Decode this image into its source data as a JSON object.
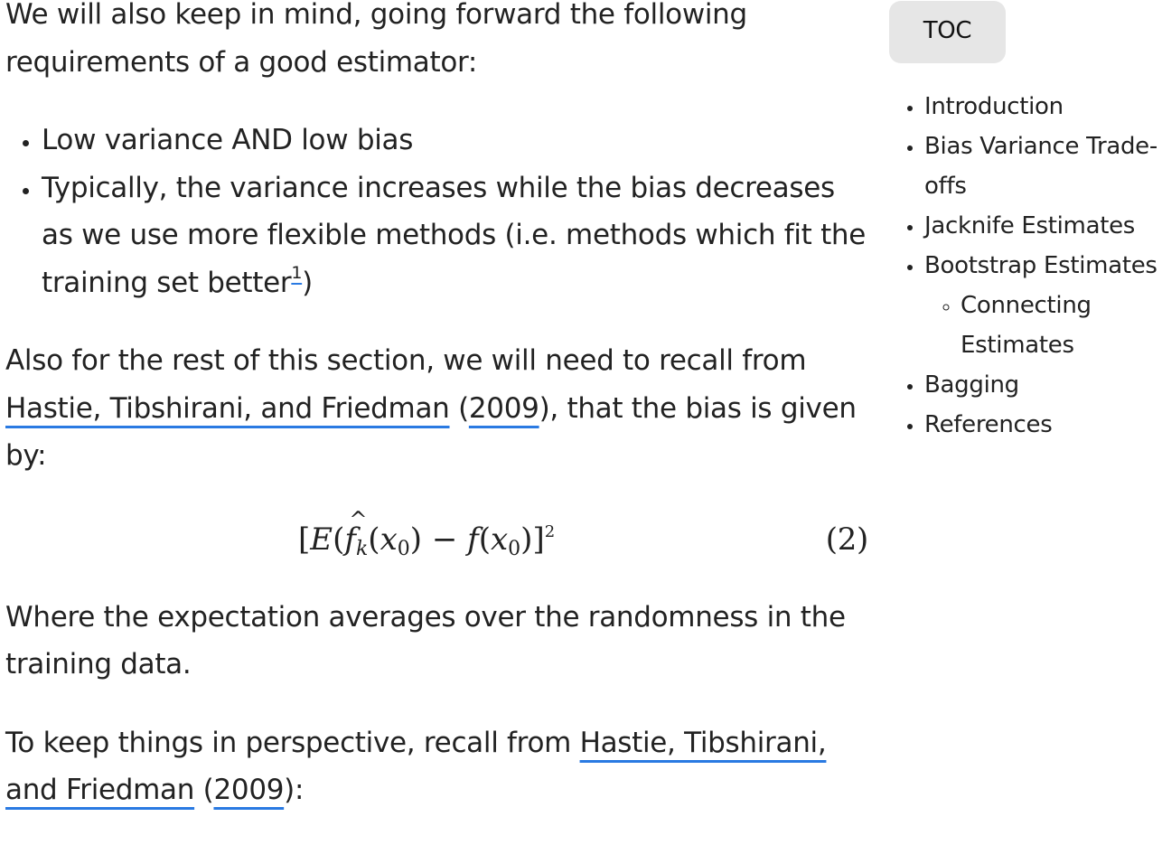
{
  "article": {
    "para1": "We will also keep in mind, going forward the following requirements of a good estimator:",
    "bullets": {
      "item1": "Low variance AND low bias",
      "item2_text": "Typically, the variance increases while the bias decreases as we use more flexible methods (i.e. methods which fit the training set better",
      "item2_footnote": "1",
      "item2_close": ")"
    },
    "para2": {
      "before": "Also for the rest of this section, we will need to recall from ",
      "cite_authors": "Hastie, Tibshirani, and Friedman",
      "paren_open": " (",
      "cite_year": "2009",
      "after": "), that the bias is given by:"
    },
    "equation": {
      "bracket_open": "[",
      "E": "E",
      "open_paren": "(",
      "f_hat": "f",
      "sub_k": "k",
      "arg1_open": "(",
      "x0a": "x",
      "sub0a": "0",
      "arg1_close": ")",
      "minus": " − ",
      "f": "f",
      "arg2_open": "(",
      "x0b": "x",
      "sub0b": "0",
      "arg2_close": ")",
      "bracket_close": "]",
      "power": "2",
      "number": "(2)"
    },
    "para3": "Where the expectation averages over the randomness in the training data.",
    "para4": {
      "before": "To keep things in perspective, recall from ",
      "cite_authors": "Hastie, Tibshirani, and Friedman",
      "paren_open": " (",
      "cite_year": "2009",
      "after": "):"
    }
  },
  "toc": {
    "button": "TOC",
    "items": [
      "Introduction",
      "Bias Variance Trade-offs",
      "Jacknife Estimates",
      "Bootstrap Estimates",
      "Connecting Estimates",
      "Bagging",
      "References"
    ]
  },
  "colors": {
    "link_underline": "#2a7ae2",
    "toc_button_bg": "#e6e6e6",
    "text": "#222222"
  }
}
